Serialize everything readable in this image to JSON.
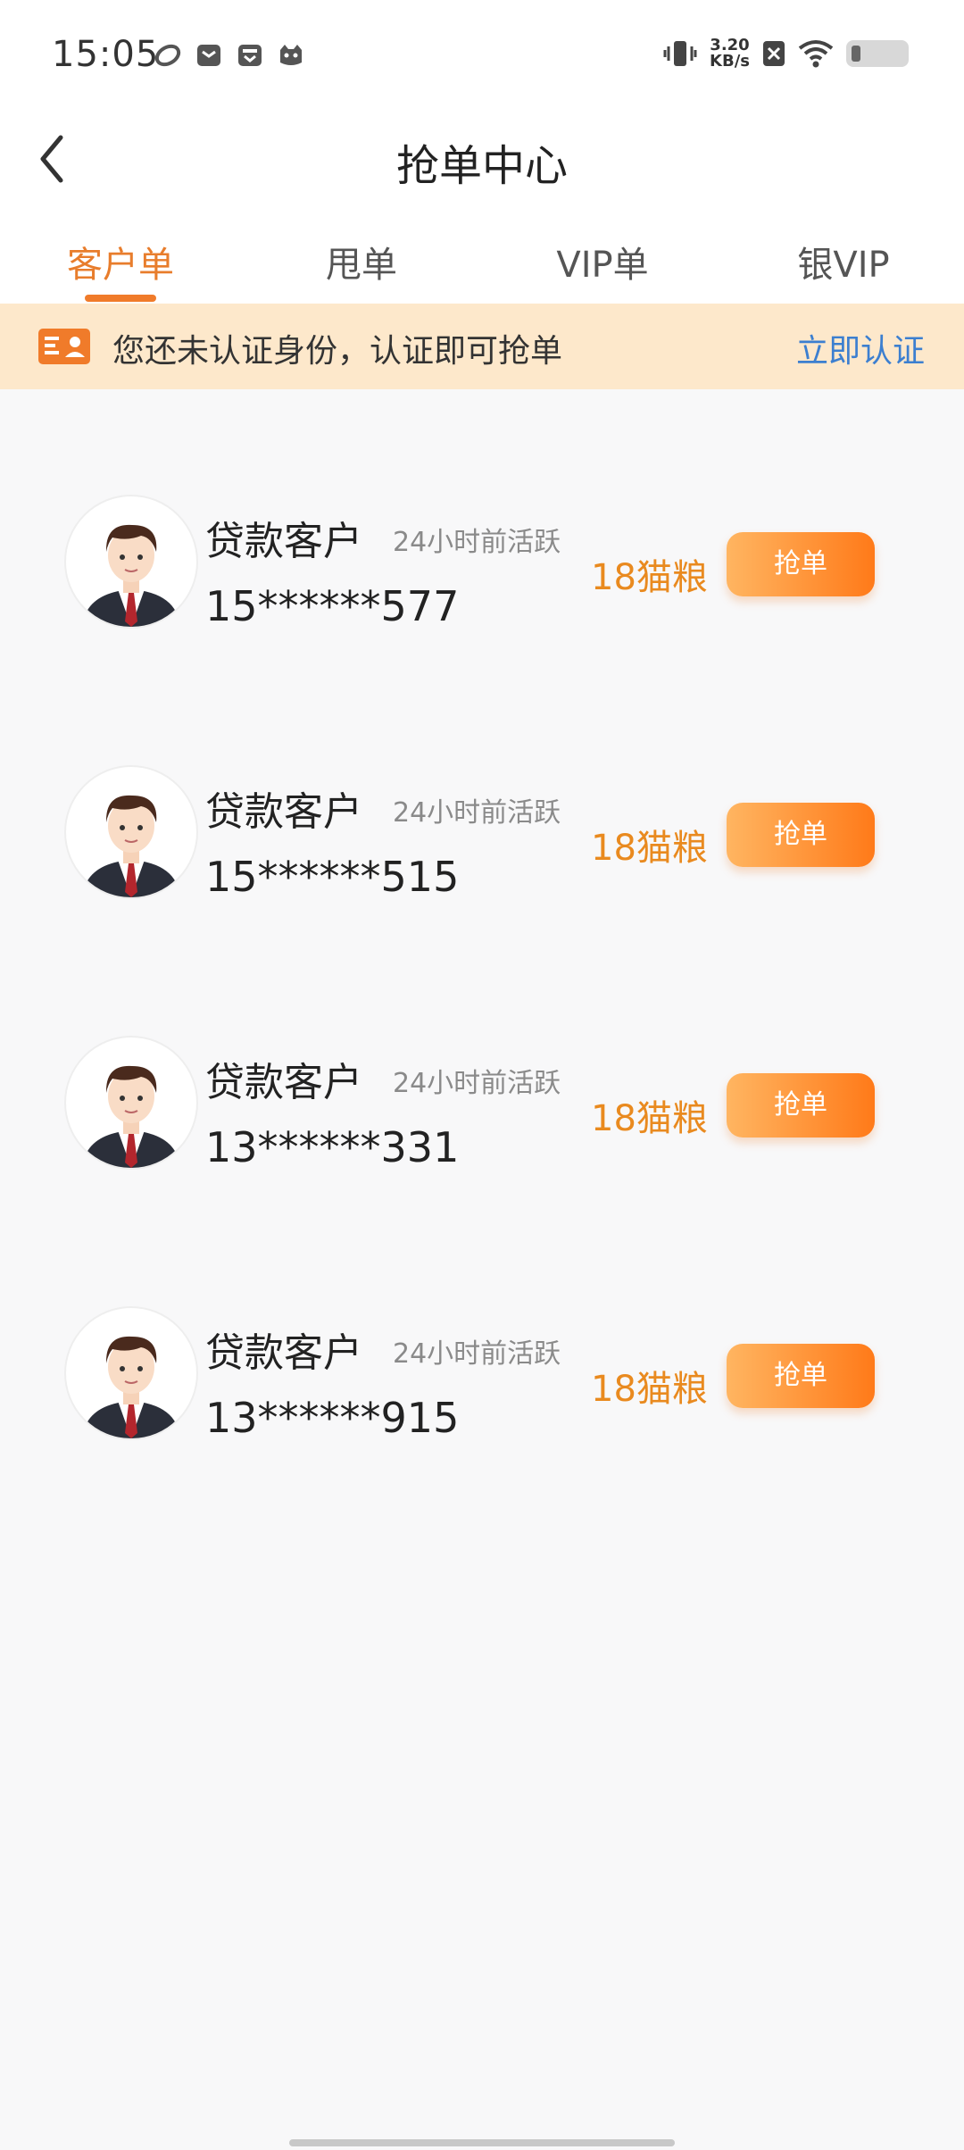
{
  "status_bar": {
    "time": "15:05",
    "net_speed_value": "3.20",
    "net_speed_unit": "KB/s",
    "left_icons": [
      "app-icon-1",
      "app-icon-2",
      "app-icon-3",
      "app-icon-4"
    ],
    "right_icons": [
      "vibrate-icon",
      "net-speed",
      "no-sim-icon",
      "wifi-icon",
      "battery-icon"
    ]
  },
  "nav": {
    "title": "抢单中心",
    "back_icon": "chevron-left-icon"
  },
  "tabs": [
    {
      "label": "客户单",
      "active": true
    },
    {
      "label": "甩单",
      "active": false
    },
    {
      "label": "VIP单",
      "active": false
    },
    {
      "label": "银VIP",
      "active": false
    }
  ],
  "notice": {
    "icon": "id-card-icon",
    "text": "您还未认证身份，认证即可抢单",
    "link_label": "立即认证"
  },
  "orders": [
    {
      "name": "贷款客户",
      "active_time": "24小时前活跃",
      "phone": "15******577",
      "price": "18猫粮",
      "button_label": "抢单"
    },
    {
      "name": "贷款客户",
      "active_time": "24小时前活跃",
      "phone": "15******515",
      "price": "18猫粮",
      "button_label": "抢单"
    },
    {
      "name": "贷款客户",
      "active_time": "24小时前活跃",
      "phone": "13******331",
      "price": "18猫粮",
      "button_label": "抢单"
    },
    {
      "name": "贷款客户",
      "active_time": "24小时前活跃",
      "phone": "13******915",
      "price": "18猫粮",
      "button_label": "抢单"
    }
  ],
  "colors": {
    "accent": "#e87d2c",
    "notice_bg": "#fde8cb",
    "link": "#3c7fd0",
    "price": "#e98a1f"
  }
}
